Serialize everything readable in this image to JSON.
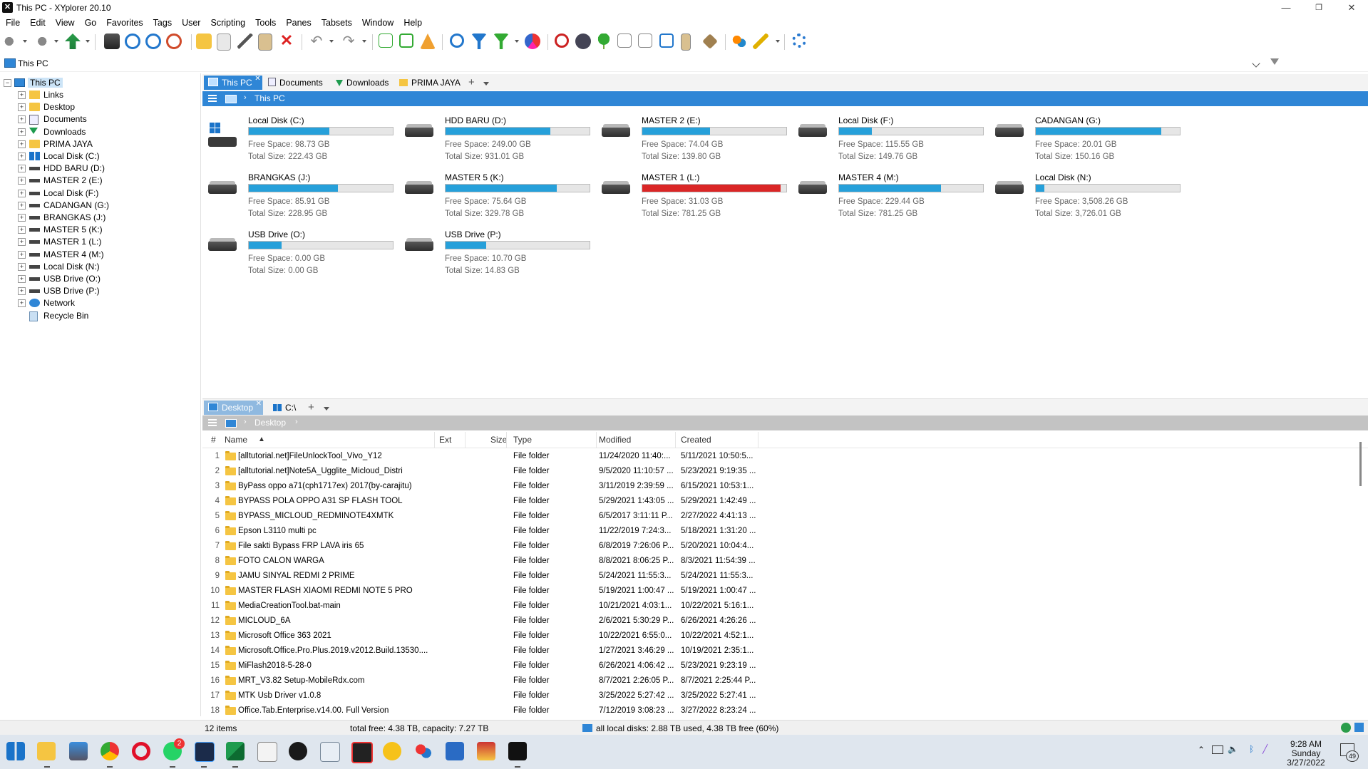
{
  "window": {
    "title": "This PC - XYplorer 20.10",
    "minimize": "—",
    "maximize": "❐",
    "close": "✕"
  },
  "menu": [
    "File",
    "Edit",
    "View",
    "Go",
    "Favorites",
    "Tags",
    "User",
    "Scripting",
    "Tools",
    "Panes",
    "Tabsets",
    "Window",
    "Help"
  ],
  "address": {
    "path": "This PC"
  },
  "tree": {
    "root": "This PC",
    "items": [
      {
        "label": "Links",
        "icon": "links-folder-icon"
      },
      {
        "label": "Desktop",
        "icon": "folder-icon"
      },
      {
        "label": "Documents",
        "icon": "documents-icon"
      },
      {
        "label": "Downloads",
        "icon": "download-icon"
      },
      {
        "label": "PRIMA JAYA",
        "icon": "folder-icon"
      },
      {
        "label": "Local Disk (C:)",
        "icon": "windows-drive-icon"
      },
      {
        "label": "HDD BARU (D:)",
        "icon": "drive-icon"
      },
      {
        "label": "MASTER 2 (E:)",
        "icon": "drive-icon"
      },
      {
        "label": "Local Disk (F:)",
        "icon": "drive-icon"
      },
      {
        "label": "CADANGAN (G:)",
        "icon": "drive-icon"
      },
      {
        "label": "BRANGKAS  (J:)",
        "icon": "drive-icon"
      },
      {
        "label": "MASTER 5 (K:)",
        "icon": "drive-icon"
      },
      {
        "label": "MASTER 1 (L:)",
        "icon": "drive-icon"
      },
      {
        "label": "MASTER 4 (M:)",
        "icon": "drive-icon"
      },
      {
        "label": "Local Disk (N:)",
        "icon": "drive-icon"
      },
      {
        "label": "USB Drive (O:)",
        "icon": "drive-icon"
      },
      {
        "label": "USB Drive (P:)",
        "icon": "drive-icon"
      },
      {
        "label": "Network",
        "icon": "network-icon"
      },
      {
        "label": "Recycle Bin",
        "icon": "recycle-bin-icon"
      }
    ]
  },
  "pane1": {
    "tabs": [
      "This PC",
      "Documents",
      "Downloads",
      "PRIMA JAYA"
    ],
    "crumb": "This PC",
    "drives": [
      {
        "name": "Local Disk (C:)",
        "free": "Free Space: 98.73 GB",
        "total": "Total Size: 222.43 GB",
        "used_pct": 56,
        "system": true
      },
      {
        "name": "HDD BARU (D:)",
        "free": "Free Space: 249.00 GB",
        "total": "Total Size: 931.01 GB",
        "used_pct": 73
      },
      {
        "name": "MASTER 2 (E:)",
        "free": "Free Space: 74.04 GB",
        "total": "Total Size: 139.80 GB",
        "used_pct": 47
      },
      {
        "name": "Local Disk (F:)",
        "free": "Free Space: 115.55 GB",
        "total": "Total Size: 149.76 GB",
        "used_pct": 23
      },
      {
        "name": "CADANGAN (G:)",
        "free": "Free Space: 20.01 GB",
        "total": "Total Size: 150.16 GB",
        "used_pct": 87
      },
      {
        "name": "BRANGKAS  (J:)",
        "free": "Free Space: 85.91 GB",
        "total": "Total Size: 228.95 GB",
        "used_pct": 62
      },
      {
        "name": "MASTER 5 (K:)",
        "free": "Free Space: 75.64 GB",
        "total": "Total Size: 329.78 GB",
        "used_pct": 77
      },
      {
        "name": "MASTER 1 (L:)",
        "free": "Free Space: 31.03 GB",
        "total": "Total Size: 781.25 GB",
        "used_pct": 96,
        "critical": true
      },
      {
        "name": "MASTER 4 (M:)",
        "free": "Free Space: 229.44 GB",
        "total": "Total Size: 781.25 GB",
        "used_pct": 71
      },
      {
        "name": "Local Disk (N:)",
        "free": "Free Space: 3,508.26 GB",
        "total": "Total Size: 3,726.01 GB",
        "used_pct": 6
      },
      {
        "name": "USB Drive (O:)",
        "free": "Free Space: 0.00 GB",
        "total": "Total Size: 0.00 GB",
        "used_pct": 23
      },
      {
        "name": "USB Drive (P:)",
        "free": "Free Space: 10.70 GB",
        "total": "Total Size: 14.83 GB",
        "used_pct": 28
      }
    ]
  },
  "pane2": {
    "tabs": [
      "Desktop",
      "C:\\"
    ],
    "crumb": "Desktop",
    "columns": {
      "num": "#",
      "name": "Name",
      "ext": "Ext",
      "size": "Size",
      "type": "Type",
      "modified": "Modified",
      "created": "Created"
    },
    "rows": [
      [
        "1",
        "[alltutorial.net]FileUnlockTool_Vivo_Y12",
        "File folder",
        "11/24/2020 11:40:...",
        "5/11/2021 10:50:5..."
      ],
      [
        "2",
        "[alltutorial.net]Note5A_Ugglite_Micloud_Distri",
        "File folder",
        "9/5/2020 11:10:57 ...",
        "5/23/2021 9:19:35 ..."
      ],
      [
        "3",
        "ByPass oppo a71(cph1717ex) 2017(by-carajitu)",
        "File folder",
        "3/11/2019 2:39:59 ...",
        "6/15/2021 10:53:1..."
      ],
      [
        "4",
        "BYPASS POLA OPPO A31 SP FLASH TOOL",
        "File folder",
        "5/29/2021 1:43:05 ...",
        "5/29/2021 1:42:49 ..."
      ],
      [
        "5",
        "BYPASS_MICLOUD_REDMINOTE4XMTK",
        "File folder",
        "6/5/2017 3:11:11 P...",
        "2/27/2022 4:41:13 ..."
      ],
      [
        "6",
        "Epson L3110 multi pc",
        "File folder",
        "11/22/2019 7:24:3...",
        "5/18/2021 1:31:20 ..."
      ],
      [
        "7",
        "File sakti Bypass FRP LAVA iris 65",
        "File folder",
        "6/8/2019 7:26:06 P...",
        "5/20/2021 10:04:4..."
      ],
      [
        "8",
        "FOTO CALON WARGA",
        "File folder",
        "8/8/2021 8:06:25 P...",
        "8/3/2021 11:54:39 ..."
      ],
      [
        "9",
        "JAMU SINYAL REDMI 2 PRIME",
        "File folder",
        "5/24/2021 11:55:3...",
        "5/24/2021 11:55:3..."
      ],
      [
        "10",
        "MASTER FLASH XIAOMI REDMI NOTE 5 PRO",
        "File folder",
        "5/19/2021 1:00:47 ...",
        "5/19/2021 1:00:47 ..."
      ],
      [
        "11",
        "MediaCreationTool.bat-main",
        "File folder",
        "10/21/2021 4:03:1...",
        "10/22/2021 5:16:1..."
      ],
      [
        "12",
        "MICLOUD_6A",
        "File folder",
        "2/6/2021 5:30:29 P...",
        "6/26/2021 4:26:26 ..."
      ],
      [
        "13",
        "Microsoft Office 363 2021",
        "File folder",
        "10/22/2021 6:55:0...",
        "10/22/2021 4:52:1..."
      ],
      [
        "14",
        "Microsoft.Office.Pro.Plus.2019.v2012.Build.13530....",
        "File folder",
        "1/27/2021 3:46:29 ...",
        "10/19/2021 2:35:1..."
      ],
      [
        "15",
        "MiFlash2018-5-28-0",
        "File folder",
        "6/26/2021 4:06:42 ...",
        "5/23/2021 9:23:19 ..."
      ],
      [
        "16",
        "MRT_V3.82 Setup-MobileRdx.com",
        "File folder",
        "8/7/2021 2:26:05 P...",
        "8/7/2021 2:25:44 P..."
      ],
      [
        "17",
        "MTK Usb Driver v1.0.8",
        "File folder",
        "3/25/2022 5:27:42 ...",
        "3/25/2022 5:27:41 ..."
      ],
      [
        "18",
        "Office.Tab.Enterprise.v14.00. Full Version",
        "File folder",
        "7/12/2019 3:08:23 ...",
        "3/27/2022 8:23:24 ..."
      ]
    ]
  },
  "status": {
    "items": "12 items",
    "free": "total free: 4.38 TB, capacity: 7.27 TB",
    "disks": "all local disks: 2.88 TB used, 4.38 TB free (60%)"
  },
  "taskbar": {
    "time": "9:28 AM",
    "day": "Sunday",
    "date": "3/27/2022",
    "whatsapp_badge": "2",
    "notif_count": "49"
  }
}
